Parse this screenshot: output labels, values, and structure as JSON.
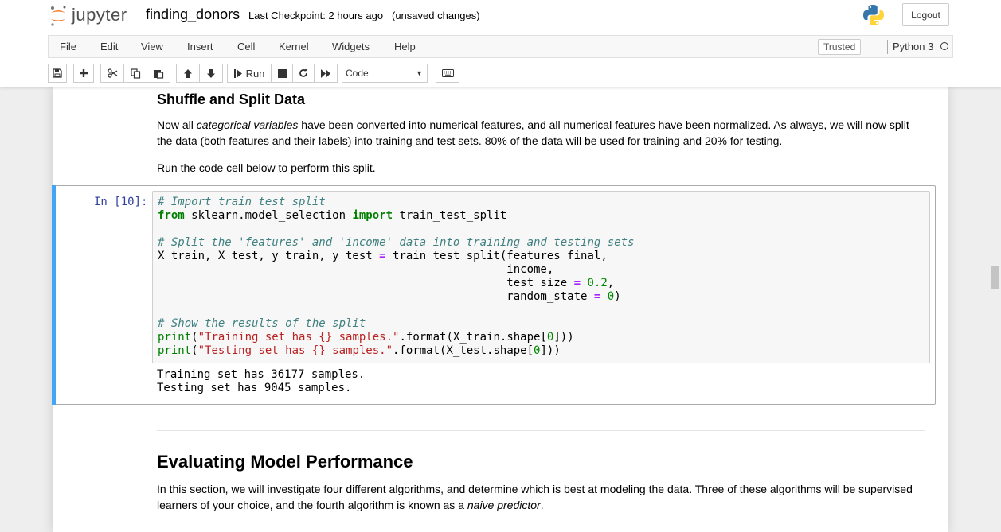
{
  "header": {
    "logo_text": "jupyter",
    "notebook_name": "finding_donors",
    "checkpoint": "Last Checkpoint: 2 hours ago",
    "autosave_status": "(unsaved changes)",
    "logout_label": "Logout"
  },
  "menubar": {
    "items": [
      "File",
      "Edit",
      "View",
      "Insert",
      "Cell",
      "Kernel",
      "Widgets",
      "Help"
    ],
    "trusted_label": "Trusted",
    "kernel_name": "Python 3"
  },
  "toolbar": {
    "run_label": "Run",
    "cell_type": "Code"
  },
  "notebook": {
    "section1_title": "Shuffle and Split Data",
    "para1_pre": "Now all ",
    "para1_em": "categorical variables",
    "para1_post_line1": " have been converted into numerical features, and all numerical features have been normalized. As always, we will now split",
    "para1_line2": "the data (both features and their labels) into training and test sets. 80% of the data will be used for training and 20% for testing.",
    "para2": "Run the code cell below to perform this split.",
    "cell_prompt": "In [10]:",
    "code": {
      "c1": "# Import train_test_split",
      "kw_from": "from",
      "module": " sklearn.model_selection ",
      "kw_import": "import",
      "imported": " train_test_split",
      "c2": "# Split the 'features' and 'income' data into training and testing sets",
      "assign_lhs": "X_train, X_test, y_train, y_test ",
      "eq": "=",
      "assign_call": " train_test_split(features_final,",
      "arg_income": "                                                    income,",
      "arg_test_size_pre": "                                                    test_size ",
      "test_size_val": "0.2",
      "arg_rs_pre": "                                                    random_state ",
      "rs_val": "0",
      "c3": "# Show the results of the split",
      "print": "print",
      "str1": "\"Training set has {} samples.\"",
      "fmt1_pre": ".format(X_train.shape[",
      "fmt1_post": "]))",
      "str2": "\"Testing set has {} samples.\"",
      "fmt2_pre": ".format(X_test.shape[",
      "fmt2_post": "]))",
      "zero": "0",
      "comma": ","
    },
    "output_line1": "Training set has 36177 samples.",
    "output_line2": "Testing set has 9045 samples.",
    "section2_title": "Evaluating Model Performance",
    "para3_line1": "In this section, we will investigate four different algorithms, and determine which is best at modeling the data. Three of these algorithms will be supervised",
    "para3_line2_pre": "learners of your choice, and the fourth algorithm is known as a ",
    "para3_em": "naive predictor",
    "para3_post": "."
  },
  "icons": {
    "save": "save-icon",
    "add": "plus-icon",
    "cut": "scissors-icon",
    "copy": "copy-icon",
    "paste": "paste-icon",
    "up": "arrow-up-icon",
    "down": "arrow-down-icon",
    "run": "step-forward-icon",
    "stop": "stop-icon",
    "restart": "refresh-icon",
    "restart_run": "fast-forward-icon",
    "keyboard": "keyboard-icon"
  },
  "colors": {
    "cell_selected_bar": "#42a5f5",
    "prompt_in": "#303f9f",
    "jupyter_orange": "#f37726"
  }
}
